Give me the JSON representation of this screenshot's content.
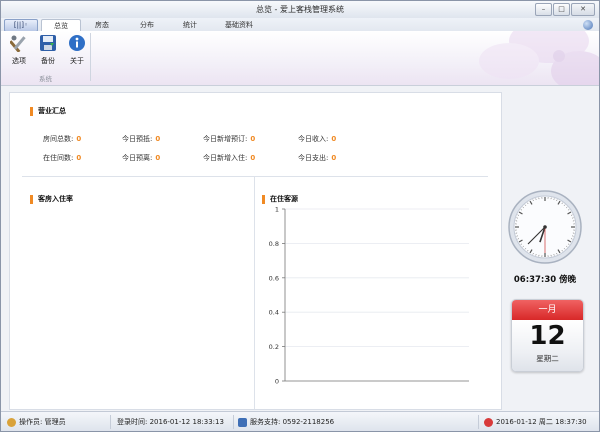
{
  "window": {
    "title": "总览 - 爱上客栈管理系统",
    "btn_min": "–",
    "btn_max": "□",
    "btn_close": "✕"
  },
  "appbutton": {
    "label": "[||]◦"
  },
  "tabs": [
    {
      "label": "总览",
      "active": true
    },
    {
      "label": "房态",
      "active": false
    },
    {
      "label": "分布",
      "active": false
    },
    {
      "label": "统计",
      "active": false
    },
    {
      "label": "基础资料",
      "active": false
    }
  ],
  "ribbon": {
    "buttons": [
      {
        "label": "选项",
        "icon": "tools-icon"
      },
      {
        "label": "备份",
        "icon": "floppy-disk-icon"
      },
      {
        "label": "关于",
        "icon": "info-icon"
      }
    ],
    "group_label": "系统"
  },
  "business": {
    "title": "营业汇总",
    "stats": [
      {
        "label": "房间总数:",
        "value": "0"
      },
      {
        "label": "今日預抵:",
        "value": "0"
      },
      {
        "label": "今日新增预订:",
        "value": "0"
      },
      {
        "label": "今日收入:",
        "value": "0"
      },
      {
        "label": "在住间数:",
        "value": "0"
      },
      {
        "label": "今日预离:",
        "value": "0"
      },
      {
        "label": "今日新增入住:",
        "value": "0"
      },
      {
        "label": "今日支出:",
        "value": "0"
      }
    ]
  },
  "occupancy": {
    "title": "客房入住率"
  },
  "source": {
    "title": "在住客源"
  },
  "chart_data": {
    "type": "bar",
    "categories": [],
    "values": [],
    "title": "在住客源",
    "xlabel": "",
    "ylabel": "",
    "ylim": [
      0,
      1
    ],
    "yticks": [
      "0",
      "0.2",
      "0.4",
      "0.6",
      "0.8",
      "1"
    ],
    "grid": true,
    "legend": "none"
  },
  "clock": {
    "time_text": "06:37:30 傍晚"
  },
  "calendar": {
    "month": "一月",
    "day": "12",
    "weekday": "星期二"
  },
  "statusbar": {
    "operator": "操作员: 管理员",
    "login": "登录时间: 2016-01-12 18:33:13",
    "support": "服务支持: 0592-2118256",
    "datetime": "2016-01-12 周二 18:37:30"
  },
  "colors": {
    "accent": "#f08a24",
    "calendar_red": "#d82828",
    "window_border": "#8a95a8"
  }
}
